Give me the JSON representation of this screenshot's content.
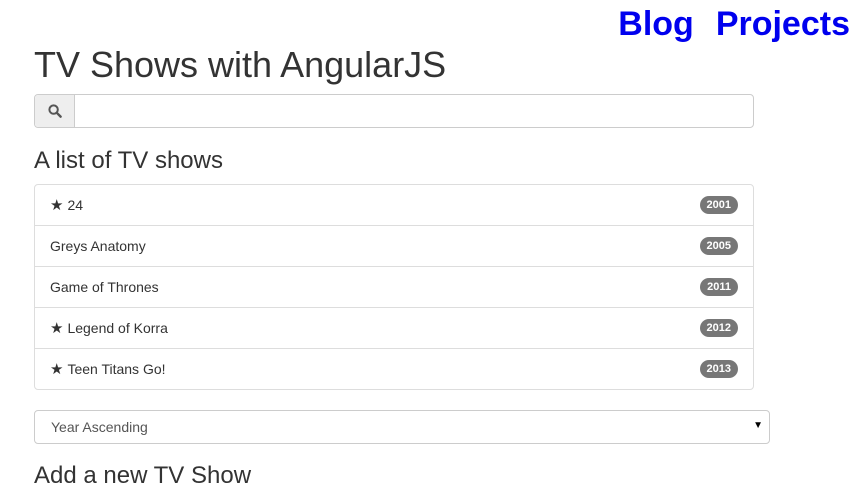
{
  "nav": {
    "blog_label": "Blog",
    "projects_label": "Projects",
    "link_color": "#0000ee"
  },
  "page": {
    "title": "TV Shows with AngularJS"
  },
  "search": {
    "icon": "search-icon",
    "value": "",
    "placeholder": ""
  },
  "list": {
    "heading": "A list of TV shows",
    "shows": [
      {
        "name": "24",
        "year": "2001",
        "starred": true
      },
      {
        "name": "Greys Anatomy",
        "year": "2005",
        "starred": false
      },
      {
        "name": "Game of Thrones",
        "year": "2011",
        "starred": false
      },
      {
        "name": "Legend of Korra",
        "year": "2012",
        "starred": true
      },
      {
        "name": "Teen Titans Go!",
        "year": "2013",
        "starred": true
      }
    ],
    "star_glyph": "★",
    "badge_color": "#777777"
  },
  "sort": {
    "selected": "Year Ascending"
  },
  "add": {
    "heading": "Add a new TV Show"
  }
}
